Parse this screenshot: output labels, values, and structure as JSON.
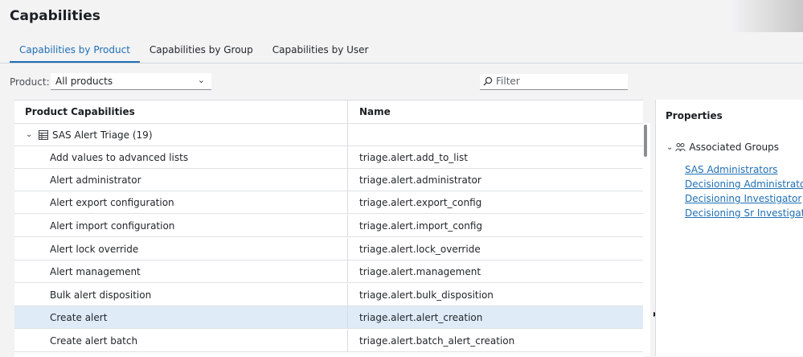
{
  "page": {
    "title": "Capabilities"
  },
  "tabs": [
    {
      "label": "Capabilities by Product",
      "active": true
    },
    {
      "label": "Capabilities by Group",
      "active": false
    },
    {
      "label": "Capabilities by User",
      "active": false
    }
  ],
  "toolbar": {
    "product_label": "Product:",
    "product_value": "All products",
    "filter_placeholder": "Filter",
    "filter_icon": "search-icon"
  },
  "grid": {
    "columns": [
      "Product Capabilities",
      "Name"
    ],
    "group": {
      "label": "SAS Alert Triage (19)",
      "expanded": true,
      "icon": "table-icon"
    },
    "rows": [
      {
        "capability": "Add values to advanced lists",
        "name": "triage.alert.add_to_list",
        "selected": false
      },
      {
        "capability": "Alert administrator",
        "name": "triage.alert.administrator",
        "selected": false
      },
      {
        "capability": "Alert export configuration",
        "name": "triage.alert.export_config",
        "selected": false
      },
      {
        "capability": "Alert import configuration",
        "name": "triage.alert.import_config",
        "selected": false
      },
      {
        "capability": "Alert lock override",
        "name": "triage.alert.lock_override",
        "selected": false
      },
      {
        "capability": "Alert management",
        "name": "triage.alert.management",
        "selected": false
      },
      {
        "capability": "Bulk alert disposition",
        "name": "triage.alert.bulk_disposition",
        "selected": false
      },
      {
        "capability": "Create alert",
        "name": "triage.alert.alert_creation",
        "selected": true
      },
      {
        "capability": "Create alert batch",
        "name": "triage.alert.batch_alert_creation",
        "selected": false
      }
    ]
  },
  "properties": {
    "title": "Properties",
    "section": {
      "label": "Associated Groups",
      "expanded": true,
      "icon": "groups-icon"
    },
    "groups": [
      "SAS Administrators",
      "Decisioning Administrator",
      "Decisioning Investigator",
      "Decisioning Sr Investigator"
    ]
  },
  "colors": {
    "accent": "#1f6fb5",
    "selected_row": "#dfebf7",
    "background": "#f3f3f4"
  }
}
